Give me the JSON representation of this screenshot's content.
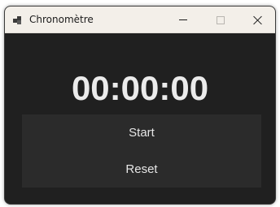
{
  "window": {
    "title": "Chronomètre",
    "icon": "app-icon"
  },
  "timer": {
    "display": "00:00:00"
  },
  "buttons": {
    "start_label": "Start",
    "reset_label": "Reset"
  },
  "colors": {
    "background": "#202020",
    "panel": "#2b2b2b",
    "titlebar": "#f3efe9",
    "text": "#ebebeb"
  }
}
